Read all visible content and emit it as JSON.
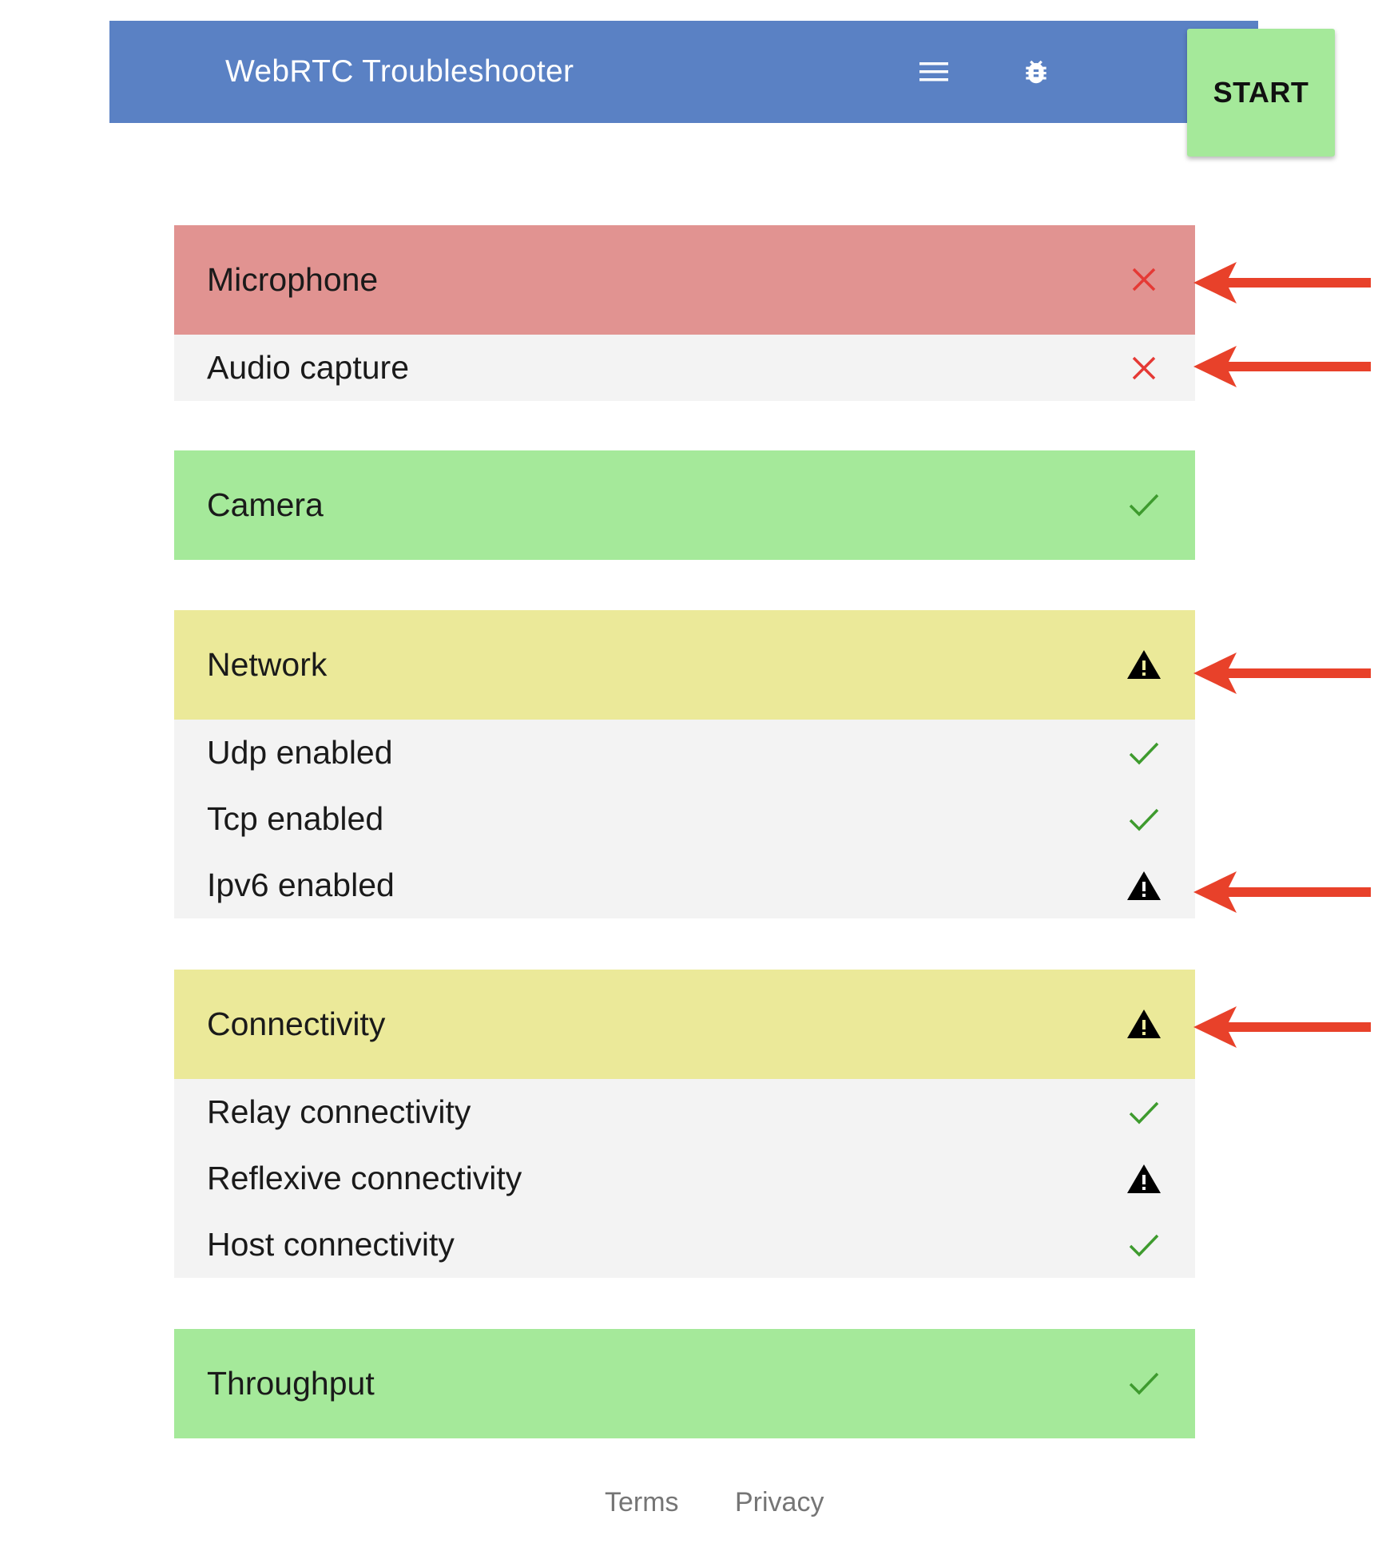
{
  "toolbar": {
    "title": "WebRTC Troubleshooter",
    "menu_icon": "menu-icon",
    "bug_icon": "bug-icon",
    "start_label": "START"
  },
  "sections": [
    {
      "label": "Microphone",
      "status": "fail",
      "items": [
        {
          "label": "Audio capture",
          "status": "fail"
        }
      ]
    },
    {
      "label": "Camera",
      "status": "pass",
      "items": []
    },
    {
      "label": "Network",
      "status": "warning",
      "items": [
        {
          "label": "Udp enabled",
          "status": "pass"
        },
        {
          "label": "Tcp enabled",
          "status": "pass"
        },
        {
          "label": "Ipv6 enabled",
          "status": "warning"
        }
      ]
    },
    {
      "label": "Connectivity",
      "status": "warning",
      "items": [
        {
          "label": "Relay connectivity",
          "status": "pass"
        },
        {
          "label": "Reflexive connectivity",
          "status": "warning"
        },
        {
          "label": "Host connectivity",
          "status": "pass"
        }
      ]
    },
    {
      "label": "Throughput",
      "status": "pass",
      "items": []
    }
  ],
  "footer": {
    "terms": "Terms",
    "privacy": "Privacy"
  },
  "colors": {
    "toolbar": "#5a81c4",
    "start_button": "#a5e99a",
    "fail_bg": "#e19391",
    "pass_bg": "#a5e99a",
    "warning_bg": "#ebe999",
    "sub_bg": "#f3f3f3",
    "fail_icon": "#e53935",
    "pass_icon": "#3e9b2e",
    "warning_icon": "#000000",
    "annotation_arrow": "#e8412a"
  },
  "status_icons": {
    "fail": "close-icon",
    "pass": "check-icon",
    "warning": "warning-icon"
  }
}
